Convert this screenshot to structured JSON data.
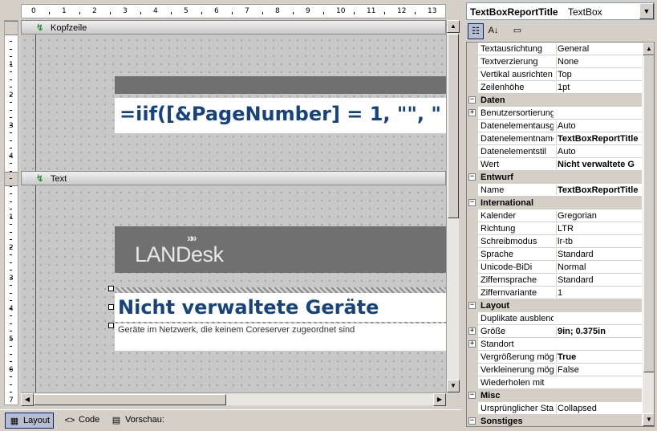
{
  "ruler": {
    "horizontal": [
      "0",
      "1",
      "2",
      "3",
      "4",
      "5",
      "6",
      "7",
      "8",
      "9",
      "10",
      "11",
      "12",
      "13"
    ],
    "vertical_top": [
      "1",
      "2",
      "3",
      "4"
    ],
    "vertical_bottom": [
      "1",
      "2",
      "3",
      "4",
      "5",
      "6",
      "7"
    ]
  },
  "bands": {
    "header": "Kopfzeile",
    "body": "Text"
  },
  "report": {
    "formula": "=iif([&PageNumber] = 1, \"\", \"",
    "logo_text": "LANDesk",
    "logo_chevrons": "»»",
    "title": "Nicht verwaltete Geräte",
    "subtitle": "Geräte im Netzwerk, die keinem Coreserver zugeordnet sind"
  },
  "tabs": [
    {
      "label": "Layout",
      "icon": "layout-icon",
      "active": true
    },
    {
      "label": "Code",
      "icon": "code-icon",
      "active": false
    },
    {
      "label": "Vorschau:",
      "icon": "preview-icon",
      "active": false
    }
  ],
  "object_selector": {
    "name": "TextBoxReportTitle",
    "type": "TextBox"
  },
  "properties": [
    {
      "kind": "prop",
      "name": "Textausrichtung",
      "value": "General"
    },
    {
      "kind": "prop",
      "name": "Textverzierung",
      "value": "None"
    },
    {
      "kind": "prop",
      "name": "Vertikal ausrichten",
      "value": "Top"
    },
    {
      "kind": "prop",
      "name": "Zeilenhöhe",
      "value": "1pt"
    },
    {
      "kind": "cat",
      "name": "Daten"
    },
    {
      "kind": "prop",
      "name": "Benutzersortierung",
      "value": "",
      "expand": true
    },
    {
      "kind": "prop",
      "name": "Datenelementausg",
      "value": "Auto"
    },
    {
      "kind": "prop",
      "name": "Datenelementname",
      "value": "TextBoxReportTitle",
      "bold": true
    },
    {
      "kind": "prop",
      "name": "Datenelementstil",
      "value": "Auto"
    },
    {
      "kind": "prop",
      "name": "Wert",
      "value": "Nicht verwaltete G",
      "bold": true
    },
    {
      "kind": "cat",
      "name": "Entwurf"
    },
    {
      "kind": "prop",
      "name": "Name",
      "value": "TextBoxReportTitle",
      "bold": true
    },
    {
      "kind": "cat",
      "name": "International"
    },
    {
      "kind": "prop",
      "name": "Kalender",
      "value": "Gregorian"
    },
    {
      "kind": "prop",
      "name": "Richtung",
      "value": "LTR"
    },
    {
      "kind": "prop",
      "name": "Schreibmodus",
      "value": "lr-tb"
    },
    {
      "kind": "prop",
      "name": "Sprache",
      "value": "Standard"
    },
    {
      "kind": "prop",
      "name": "Unicode-BiDi",
      "value": "Normal"
    },
    {
      "kind": "prop",
      "name": "Ziffernsprache",
      "value": "Standard"
    },
    {
      "kind": "prop",
      "name": "Ziffernvariante",
      "value": "1"
    },
    {
      "kind": "cat",
      "name": "Layout"
    },
    {
      "kind": "prop",
      "name": "Duplikate ausblend",
      "value": ""
    },
    {
      "kind": "prop",
      "name": "Größe",
      "value": "9in; 0.375in",
      "bold": true,
      "expand": true
    },
    {
      "kind": "prop",
      "name": "Standort",
      "value": "",
      "expand": true
    },
    {
      "kind": "prop",
      "name": "Vergrößerung mögl",
      "value": "True",
      "bold": true
    },
    {
      "kind": "prop",
      "name": "Verkleinerung mögl",
      "value": "False"
    },
    {
      "kind": "prop",
      "name": "Wiederholen mit",
      "value": ""
    },
    {
      "kind": "cat",
      "name": "Misc"
    },
    {
      "kind": "prop",
      "name": "Ursprünglicher Sta",
      "value": "Collapsed"
    },
    {
      "kind": "cat",
      "name": "Sonstiges"
    }
  ]
}
